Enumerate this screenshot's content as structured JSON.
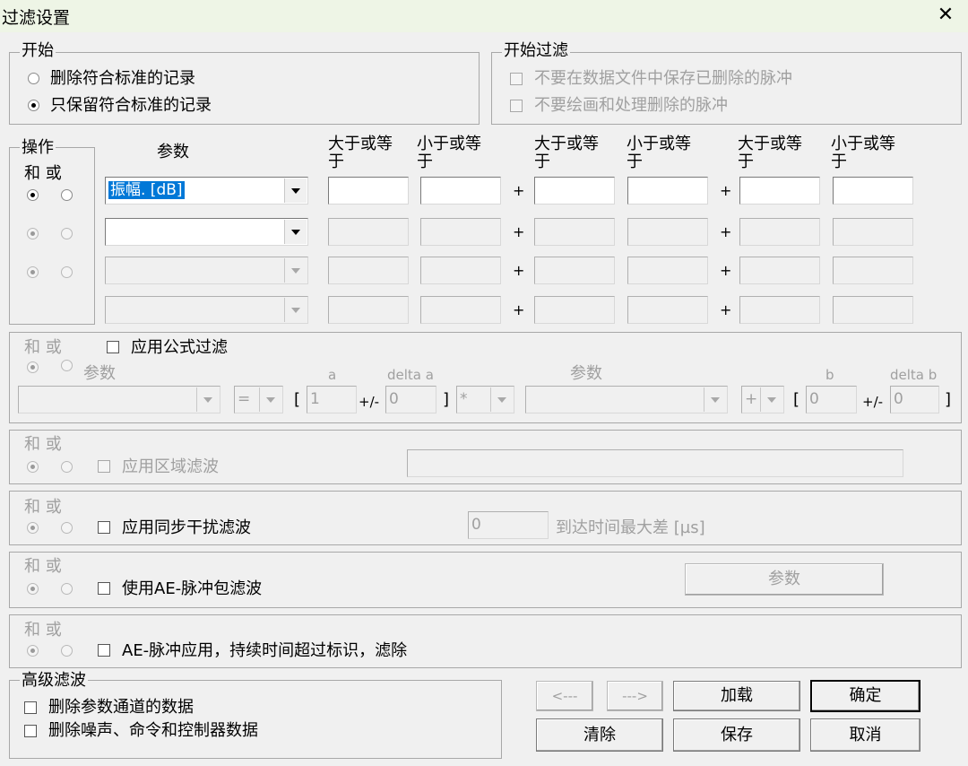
{
  "window": {
    "title": "过滤设置",
    "close_label": "✕"
  },
  "start_group": {
    "legend": "开始",
    "delete_label": "删除符合标准的记录",
    "keep_label": "只保留符合标准的记录"
  },
  "start_filter": {
    "legend": "开始过滤",
    "opt1": "不要在数据文件中保存已删除的脉冲",
    "opt2": "不要绘画和处理删除的脉冲"
  },
  "ops": {
    "legend": "操作",
    "and_or": "和 或"
  },
  "params": {
    "header": "参数",
    "col_ge": "大于或等于",
    "col_le": "小于或等于",
    "plus": "+",
    "row1_value": "振幅. [dB]"
  },
  "formula": {
    "and_or": "和 或",
    "apply_label": "应用公式过滤",
    "param_label": "参数",
    "a_label": "a",
    "delta_a_label": "delta a",
    "b_label": "b",
    "delta_b_label": "delta b",
    "op1": "=",
    "a_value": "1",
    "pm": "+/-",
    "delta_a_value": "0",
    "op2": "*",
    "op3": "+",
    "b_value": "0",
    "delta_b_value": "0",
    "lbr": "[",
    "rbr": "]"
  },
  "region": {
    "and_or": "和 或",
    "label": "应用区域滤波"
  },
  "sync": {
    "and_or": "和 或",
    "label": "应用同步干扰滤波",
    "value": "0",
    "unit_label": "到达时间最大差 [µs]"
  },
  "packet": {
    "and_or": "和 或",
    "label": "使用AE-脉冲包滤波",
    "param_button": "参数"
  },
  "duration": {
    "and_or": "和 或",
    "label": "AE-脉冲应用，持续时间超过标识，滤除"
  },
  "advanced": {
    "legend": "高级滤波",
    "opt1": "删除参数通道的数据",
    "opt2": "删除噪声、命令和控制器数据"
  },
  "buttons": {
    "prev": "<---",
    "next": "--->",
    "load": "加载",
    "ok": "确定",
    "clear": "清除",
    "save": "保存",
    "cancel": "取消"
  }
}
